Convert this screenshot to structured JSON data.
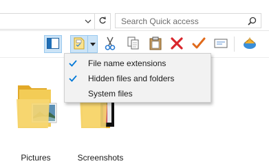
{
  "search": {
    "placeholder": "Search Quick access"
  },
  "view_menu": {
    "items": [
      {
        "label": "File name extensions",
        "checked": true
      },
      {
        "label": "Hidden files and folders",
        "checked": true
      },
      {
        "label": "System files",
        "checked": false
      }
    ]
  },
  "folders": [
    {
      "label": "Pictures"
    },
    {
      "label": "Screenshots"
    }
  ],
  "colors": {
    "accent": "#0078d7",
    "pressed_bg": "#cce4f7",
    "pressed_border": "#99c9ef",
    "folder_yellow": "#f3cc56",
    "delete_red": "#d9262c",
    "check_orange": "#e06a1b"
  },
  "icons": [
    "chevron-down-icon",
    "refresh-icon",
    "search-icon",
    "navigation-pane-icon",
    "view-options-icon",
    "cut-icon",
    "copy-icon",
    "paste-icon",
    "delete-icon",
    "properties-check-icon",
    "rename-icon",
    "shell-icon",
    "checkmark-icon"
  ]
}
